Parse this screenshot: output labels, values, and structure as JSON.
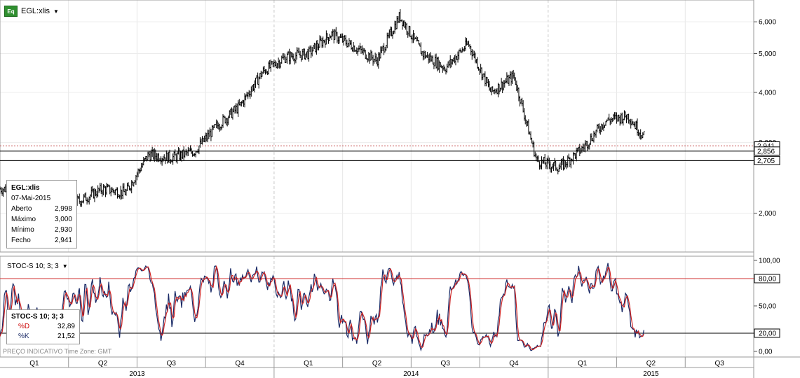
{
  "symbol": {
    "icon_label": "Eq",
    "name": "EGL:xlis",
    "caret": "▼"
  },
  "price_info": {
    "title": "EGL:xlis",
    "date": "07-Mai-2015",
    "rows": [
      {
        "label": "Aberto",
        "value": "2,998"
      },
      {
        "label": "Máximo",
        "value": "3,000"
      },
      {
        "label": "Mínimo",
        "value": "2,930"
      },
      {
        "label": "Fecho",
        "value": "2,941"
      }
    ]
  },
  "stoc_panel": {
    "title": "STOC-S 10; 3; 3",
    "caret": "▼"
  },
  "stoc_info": {
    "title": "STOC-S 10; 3; 3",
    "rows": [
      {
        "label": "%D",
        "value": "32,89",
        "color": "#cc0000"
      },
      {
        "label": "%K",
        "value": "21,52",
        "color": "#1a2a66"
      }
    ]
  },
  "footer_note": "PREÇO INDICATIVO   Time Zone: GMT",
  "chart_data": [
    {
      "type": "ohlc",
      "series_name": "EGL:xlis",
      "y_scale": "log",
      "ylim": [
        1.6,
        6.8
      ],
      "y_ticks": [
        {
          "value": 2.0,
          "label": "2,000"
        },
        {
          "value": 3.0,
          "label": "3,000"
        },
        {
          "value": 4.0,
          "label": "4,000"
        },
        {
          "value": 5.0,
          "label": "5,000"
        },
        {
          "value": 6.0,
          "label": "6,000"
        }
      ],
      "horizontal_lines": [
        {
          "value": 2.856,
          "label": "2,856"
        },
        {
          "value": 2.705,
          "label": "2,705"
        }
      ],
      "last_value_marker": {
        "value": 2.941,
        "label": "2,941"
      },
      "x_range": [
        "2013-01",
        "2015-09"
      ],
      "quarter_labels": [
        "Q1",
        "Q2",
        "Q3",
        "Q4",
        "Q1",
        "Q2",
        "Q3",
        "Q4",
        "Q1",
        "Q2",
        "Q3"
      ],
      "year_labels": [
        "2013",
        "2014",
        "2015"
      ],
      "approx_closes": [
        {
          "x": "2013-01",
          "y": 2.3
        },
        {
          "x": "2013-02",
          "y": 2.25
        },
        {
          "x": "2013-03",
          "y": 2.1
        },
        {
          "x": "2013-04",
          "y": 2.15
        },
        {
          "x": "2013-05",
          "y": 2.3
        },
        {
          "x": "2013-06",
          "y": 2.25
        },
        {
          "x": "2013-07",
          "y": 2.8
        },
        {
          "x": "2013-08",
          "y": 2.75
        },
        {
          "x": "2013-09",
          "y": 2.85
        },
        {
          "x": "2013-10",
          "y": 3.3
        },
        {
          "x": "2013-11",
          "y": 3.7
        },
        {
          "x": "2013-12",
          "y": 4.5
        },
        {
          "x": "2014-01",
          "y": 4.9
        },
        {
          "x": "2014-02",
          "y": 5.0
        },
        {
          "x": "2014-03",
          "y": 5.6
        },
        {
          "x": "2014-04",
          "y": 5.2
        },
        {
          "x": "2014-05",
          "y": 4.8
        },
        {
          "x": "2014-06",
          "y": 6.2
        },
        {
          "x": "2014-07",
          "y": 5.0
        },
        {
          "x": "2014-08",
          "y": 4.6
        },
        {
          "x": "2014-09",
          "y": 5.3
        },
        {
          "x": "2014-10",
          "y": 4.0
        },
        {
          "x": "2014-11",
          "y": 4.4
        },
        {
          "x": "2014-12",
          "y": 2.7
        },
        {
          "x": "2015-01",
          "y": 2.6
        },
        {
          "x": "2015-02",
          "y": 2.9
        },
        {
          "x": "2015-03",
          "y": 3.4
        },
        {
          "x": "2015-04",
          "y": 3.5
        },
        {
          "x": "2015-05",
          "y": 2.94
        }
      ]
    },
    {
      "type": "line",
      "series_name": "STOC-S 10; 3; 3",
      "ylim": [
        0,
        100
      ],
      "y_ticks": [
        {
          "value": 0,
          "label": "0,00"
        },
        {
          "value": 20,
          "label": "20,00"
        },
        {
          "value": 50,
          "label": "50,00"
        },
        {
          "value": 80,
          "label": "80,00"
        },
        {
          "value": 100,
          "label": "100,00"
        }
      ],
      "reference_lines": [
        {
          "value": 80,
          "label": "80,00",
          "color": "#d03030"
        },
        {
          "value": 20,
          "label": "20,00",
          "color": "#000000"
        }
      ],
      "series": [
        {
          "name": "%D",
          "color": "#cc2222",
          "last": 32.89
        },
        {
          "name": "%K",
          "color": "#1a2a66",
          "last": 21.52
        }
      ]
    }
  ]
}
